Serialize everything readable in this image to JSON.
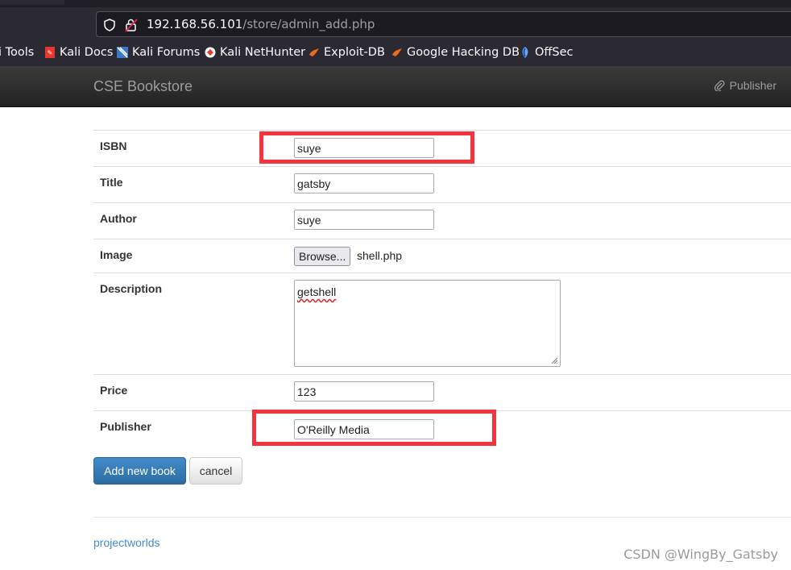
{
  "browser": {
    "url_host": "192.168.56.101",
    "url_path": "/store/admin_add.php",
    "bookmarks": [
      {
        "label": "i Tools",
        "icon": "kali-tools-icon"
      },
      {
        "label": "Kali Docs",
        "icon": "kali-docs-icon"
      },
      {
        "label": "Kali Forums",
        "icon": "kali-forums-icon"
      },
      {
        "label": "Kali NetHunter",
        "icon": "kali-nethunter-icon"
      },
      {
        "label": "Exploit-DB",
        "icon": "exploit-db-icon"
      },
      {
        "label": "Google Hacking DB",
        "icon": "google-hacking-db-icon"
      },
      {
        "label": "OffSec",
        "icon": "offsec-icon"
      }
    ]
  },
  "site": {
    "brand": "CSE Bookstore",
    "nav_publisher": "Publisher"
  },
  "form": {
    "isbn": {
      "label": "ISBN",
      "value": "suye"
    },
    "title": {
      "label": "Title",
      "value": "gatsby"
    },
    "author": {
      "label": "Author",
      "value": "suye"
    },
    "image": {
      "label": "Image",
      "browse_label": "Browse...",
      "file_name": "shell.php"
    },
    "description": {
      "label": "Description",
      "value": "getshell"
    },
    "price": {
      "label": "Price",
      "value": "123"
    },
    "publisher": {
      "label": "Publisher",
      "value": "O'Reilly Media"
    },
    "submit_label": "Add new book",
    "cancel_label": "cancel"
  },
  "footer": {
    "link": "projectworlds"
  },
  "watermark": "CSDN @WingBy_Gatsby",
  "colors": {
    "annotation_red": "#f4343c",
    "primary_button": "#337ab7",
    "link": "#428bca"
  }
}
